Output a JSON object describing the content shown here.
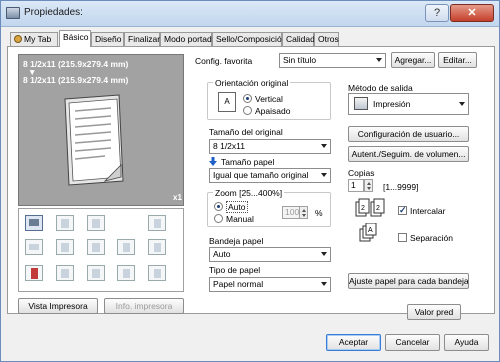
{
  "window": {
    "title": "Propiedades:"
  },
  "tabs": [
    {
      "label": "My Tab"
    },
    {
      "label": "Básico"
    },
    {
      "label": "Diseño"
    },
    {
      "label": "Finalizar"
    },
    {
      "label": "Modo portada"
    },
    {
      "label": "Sello/Composición"
    },
    {
      "label": "Calidad"
    },
    {
      "label": "Otros"
    }
  ],
  "favorites": {
    "label": "Config. favorita",
    "value": "Sin título",
    "add_button": "Agregar...",
    "edit_button": "Editar..."
  },
  "preview": {
    "line1": "8 1/2x11 (215.9x279.4 mm)",
    "arrow": "▼",
    "line2": "8 1/2x11 (215.9x279.4 mm)",
    "copies_badge": "x1"
  },
  "left_buttons": {
    "printer_view": "Vista Impresora",
    "printer_info": "Info. impresora"
  },
  "orientation": {
    "title": "Orientación original",
    "vertical": "Vertical",
    "horizontal": "Apaisado",
    "selected": "Vertical"
  },
  "original_size": {
    "label": "Tamaño del original",
    "value": "8 1/2x11"
  },
  "paper_size": {
    "label": "Tamaño papel",
    "value": "Igual que tamaño original"
  },
  "zoom": {
    "title": "Zoom [25...400%]",
    "auto": "Auto",
    "manual": "Manual",
    "value": "100",
    "unit": "%",
    "selected": "Auto"
  },
  "paper_tray": {
    "label": "Bandeja papel",
    "value": "Auto"
  },
  "paper_type": {
    "label": "Tipo de papel",
    "value": "Papel normal"
  },
  "output": {
    "label": "Método de salida",
    "value": "Impresión",
    "user_settings_button": "Configuración de usuario...",
    "auth_button": "Autent./Seguim. de volumen..."
  },
  "copies": {
    "label": "Copias",
    "value": "1",
    "range": "[1...9999]",
    "collate": "Intercalar",
    "collate_checked": true,
    "separation": "Separación",
    "separation_checked": false
  },
  "adjust_button": "Ajuste papel para cada bandeja...",
  "default_button": "Valor pred",
  "footer": {
    "ok": "Aceptar",
    "cancel": "Cancelar",
    "help": "Ayuda"
  },
  "colors": {
    "title_bar": "#c8dbf2",
    "preview_bg": "#a2a2a2",
    "accent": "#3a7bd5"
  }
}
